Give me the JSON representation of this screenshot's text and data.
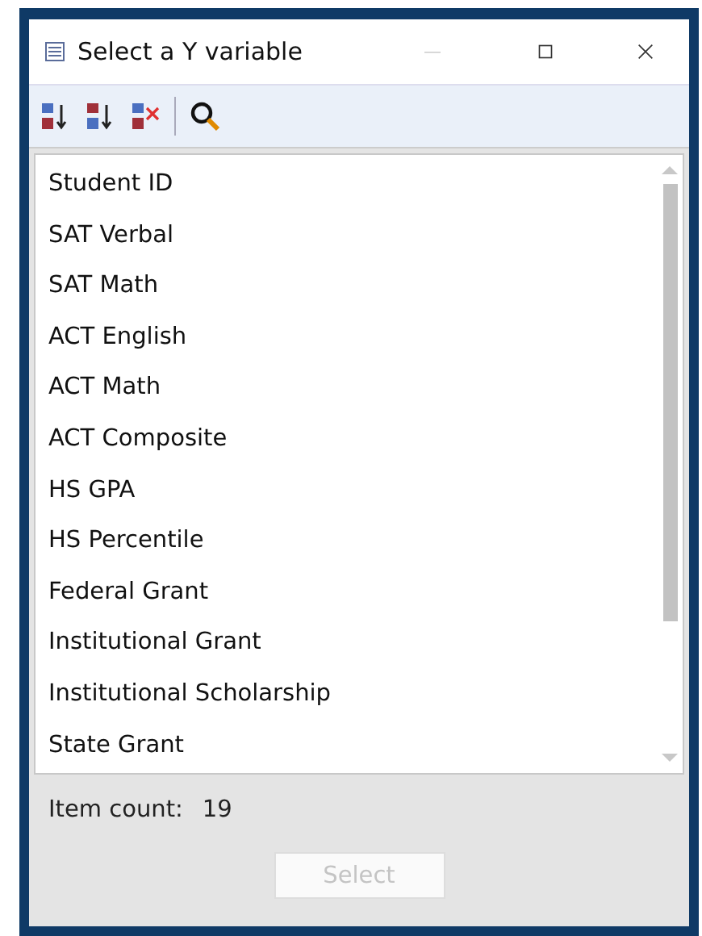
{
  "window": {
    "title": "Select a Y variable",
    "minimize_disabled": true
  },
  "toolbar": [
    {
      "kind": "sort-asc"
    },
    {
      "kind": "sort-desc"
    },
    {
      "kind": "clear-sort"
    },
    {
      "kind": "search"
    }
  ],
  "list": {
    "items": [
      {
        "label": "Student ID"
      },
      {
        "label": "SAT Verbal"
      },
      {
        "label": "SAT Math"
      },
      {
        "label": "ACT English"
      },
      {
        "label": "ACT Math"
      },
      {
        "label": "ACT Composite"
      },
      {
        "label": "HS GPA"
      },
      {
        "label": "HS Percentile"
      },
      {
        "label": "Federal Grant"
      },
      {
        "label": "Institutional Grant"
      },
      {
        "label": "Institutional Scholarship"
      },
      {
        "label": "State Grant"
      }
    ]
  },
  "status": {
    "label": "Item count:",
    "count": "19"
  },
  "select_button": {
    "label": "Select",
    "disabled": true
  }
}
